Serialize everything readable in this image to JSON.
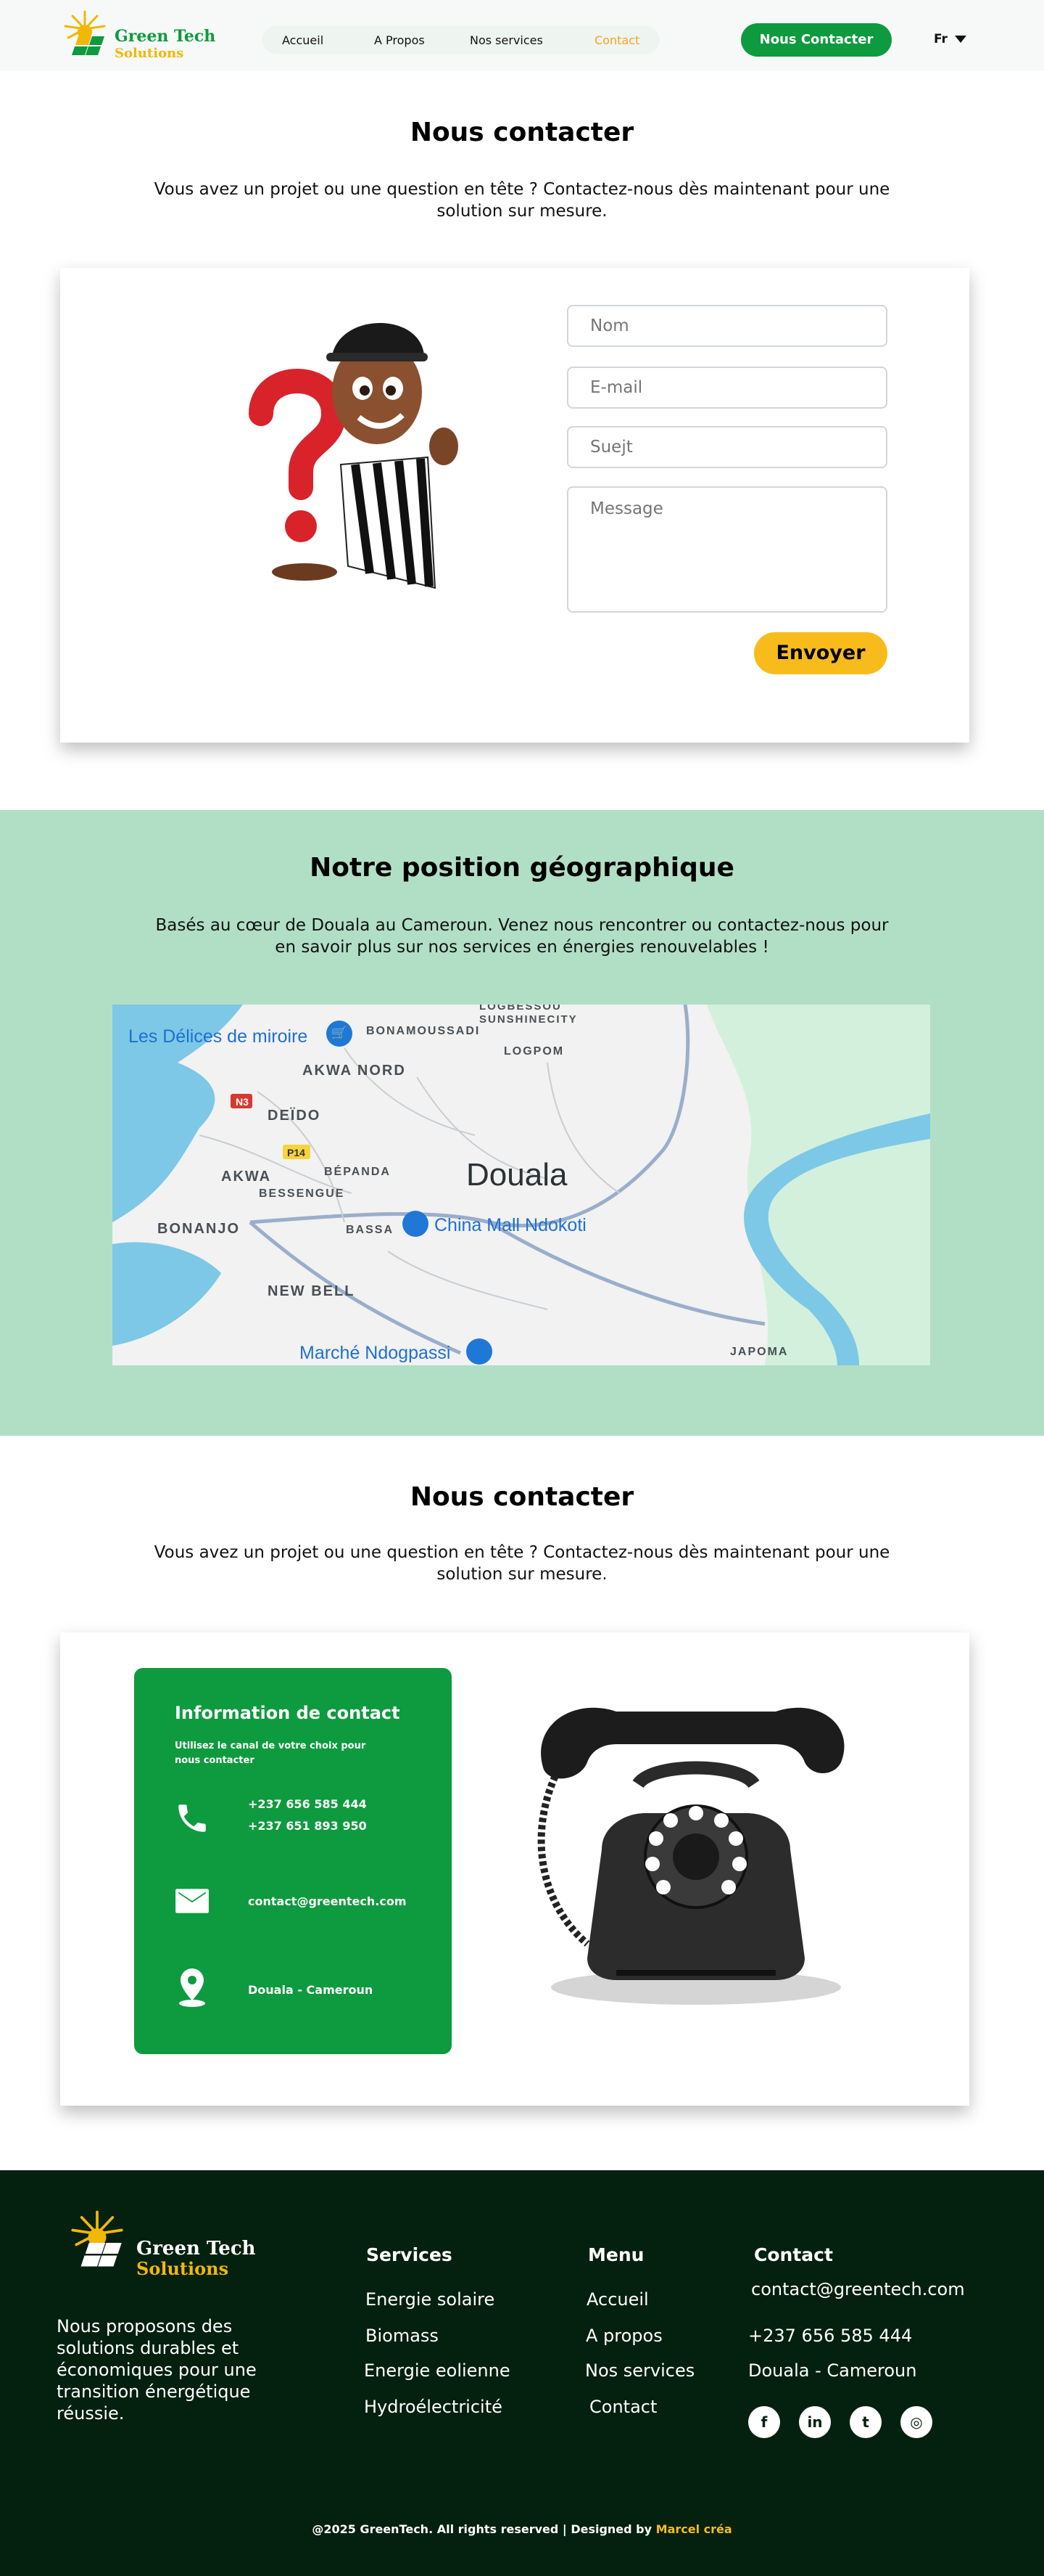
{
  "header": {
    "logo_line1": "Green Tech",
    "logo_line2": "Solutions",
    "nav": [
      "Accueil",
      "A Propos",
      "Nos services",
      "Contact"
    ],
    "active_nav": "Contact",
    "cta_label": "Nous Contacter",
    "language": "Fr"
  },
  "contact_form_section": {
    "title": "Nous contacter",
    "subtitle": "Vous avez un projet ou une question en tête ? Contactez-nous dès maintenant pour une solution sur mesure.",
    "fields": {
      "name_placeholder": "Nom",
      "email_placeholder": "E-mail",
      "subject_placeholder": "Suejt",
      "message_placeholder": "Message"
    },
    "submit_label": "Envoyer"
  },
  "location_section": {
    "title": "Notre position géographique",
    "subtitle": "Basés au cœur de Douala au Cameroun. Venez nous rencontrer ou contactez-nous pour en savoir plus sur nos services en énergies renouvelables !",
    "map_labels": {
      "city": "Douala",
      "poi_1": "Les Délices de miroire",
      "poi_2": "China Mall Ndokoti",
      "poi_3": "Marché Ndogpassi",
      "akwa_nord": "AKWA NORD",
      "deido": "DEÏDO",
      "akwa": "AKWA",
      "bessengue": "BESSENGUE",
      "bonanjo": "BONANJO",
      "bassa": "BASSA",
      "bepanda": "BÉPANDA",
      "new_bell": "NEW BELL",
      "logpom": "LOGPOM",
      "bonamoussadi": "BONAMOUSSADI",
      "sunshinecity": "SUNSHINECITY",
      "logbessou": "LOGBESSOU",
      "japoma": "JAPOMA",
      "route_n3": "N3",
      "route_p14": "P14"
    }
  },
  "contact_info_section": {
    "title": "Nous contacter",
    "subtitle": "Vous avez un projet ou une question en tête ? Contactez-nous dès maintenant pour une solution sur mesure.",
    "box_title": "Information de contact",
    "box_subtitle": "Utilisez le canal de votre choix pour nous contacter",
    "phone_1": "+237 656 585 444",
    "phone_2": "+237 651 893 950",
    "email": "contact@greentech.com",
    "address": "Douala - Cameroun"
  },
  "footer": {
    "logo_line1": "Green Tech",
    "logo_line2": "Solutions",
    "description": "Nous proposons des solutions durables et économiques pour une transition énergétique réussie.",
    "services_heading": "Services",
    "services": [
      "Energie solaire",
      "Biomass",
      "Energie eolienne",
      "Hydroélectricité"
    ],
    "menu_heading": "Menu",
    "menu": [
      "Accueil",
      "A propos",
      "Nos services",
      "Contact"
    ],
    "contact_heading": "Contact",
    "contact_email": "contact@greentech.com",
    "contact_phone": "+237 656 585 444",
    "contact_address": "Douala - Cameroun",
    "socials": [
      "facebook-icon",
      "linkedin-icon",
      "twitter-icon",
      "instagram-icon"
    ],
    "copyright": "@2025 GreenTech. All rights reserved | Designed by",
    "designer": "Marcel créa"
  },
  "colors": {
    "brand_green": "#0e9a3e",
    "accent_yellow": "#f7bc1c",
    "band_green": "#b1dfc6",
    "footer_dark": "#04200f"
  }
}
